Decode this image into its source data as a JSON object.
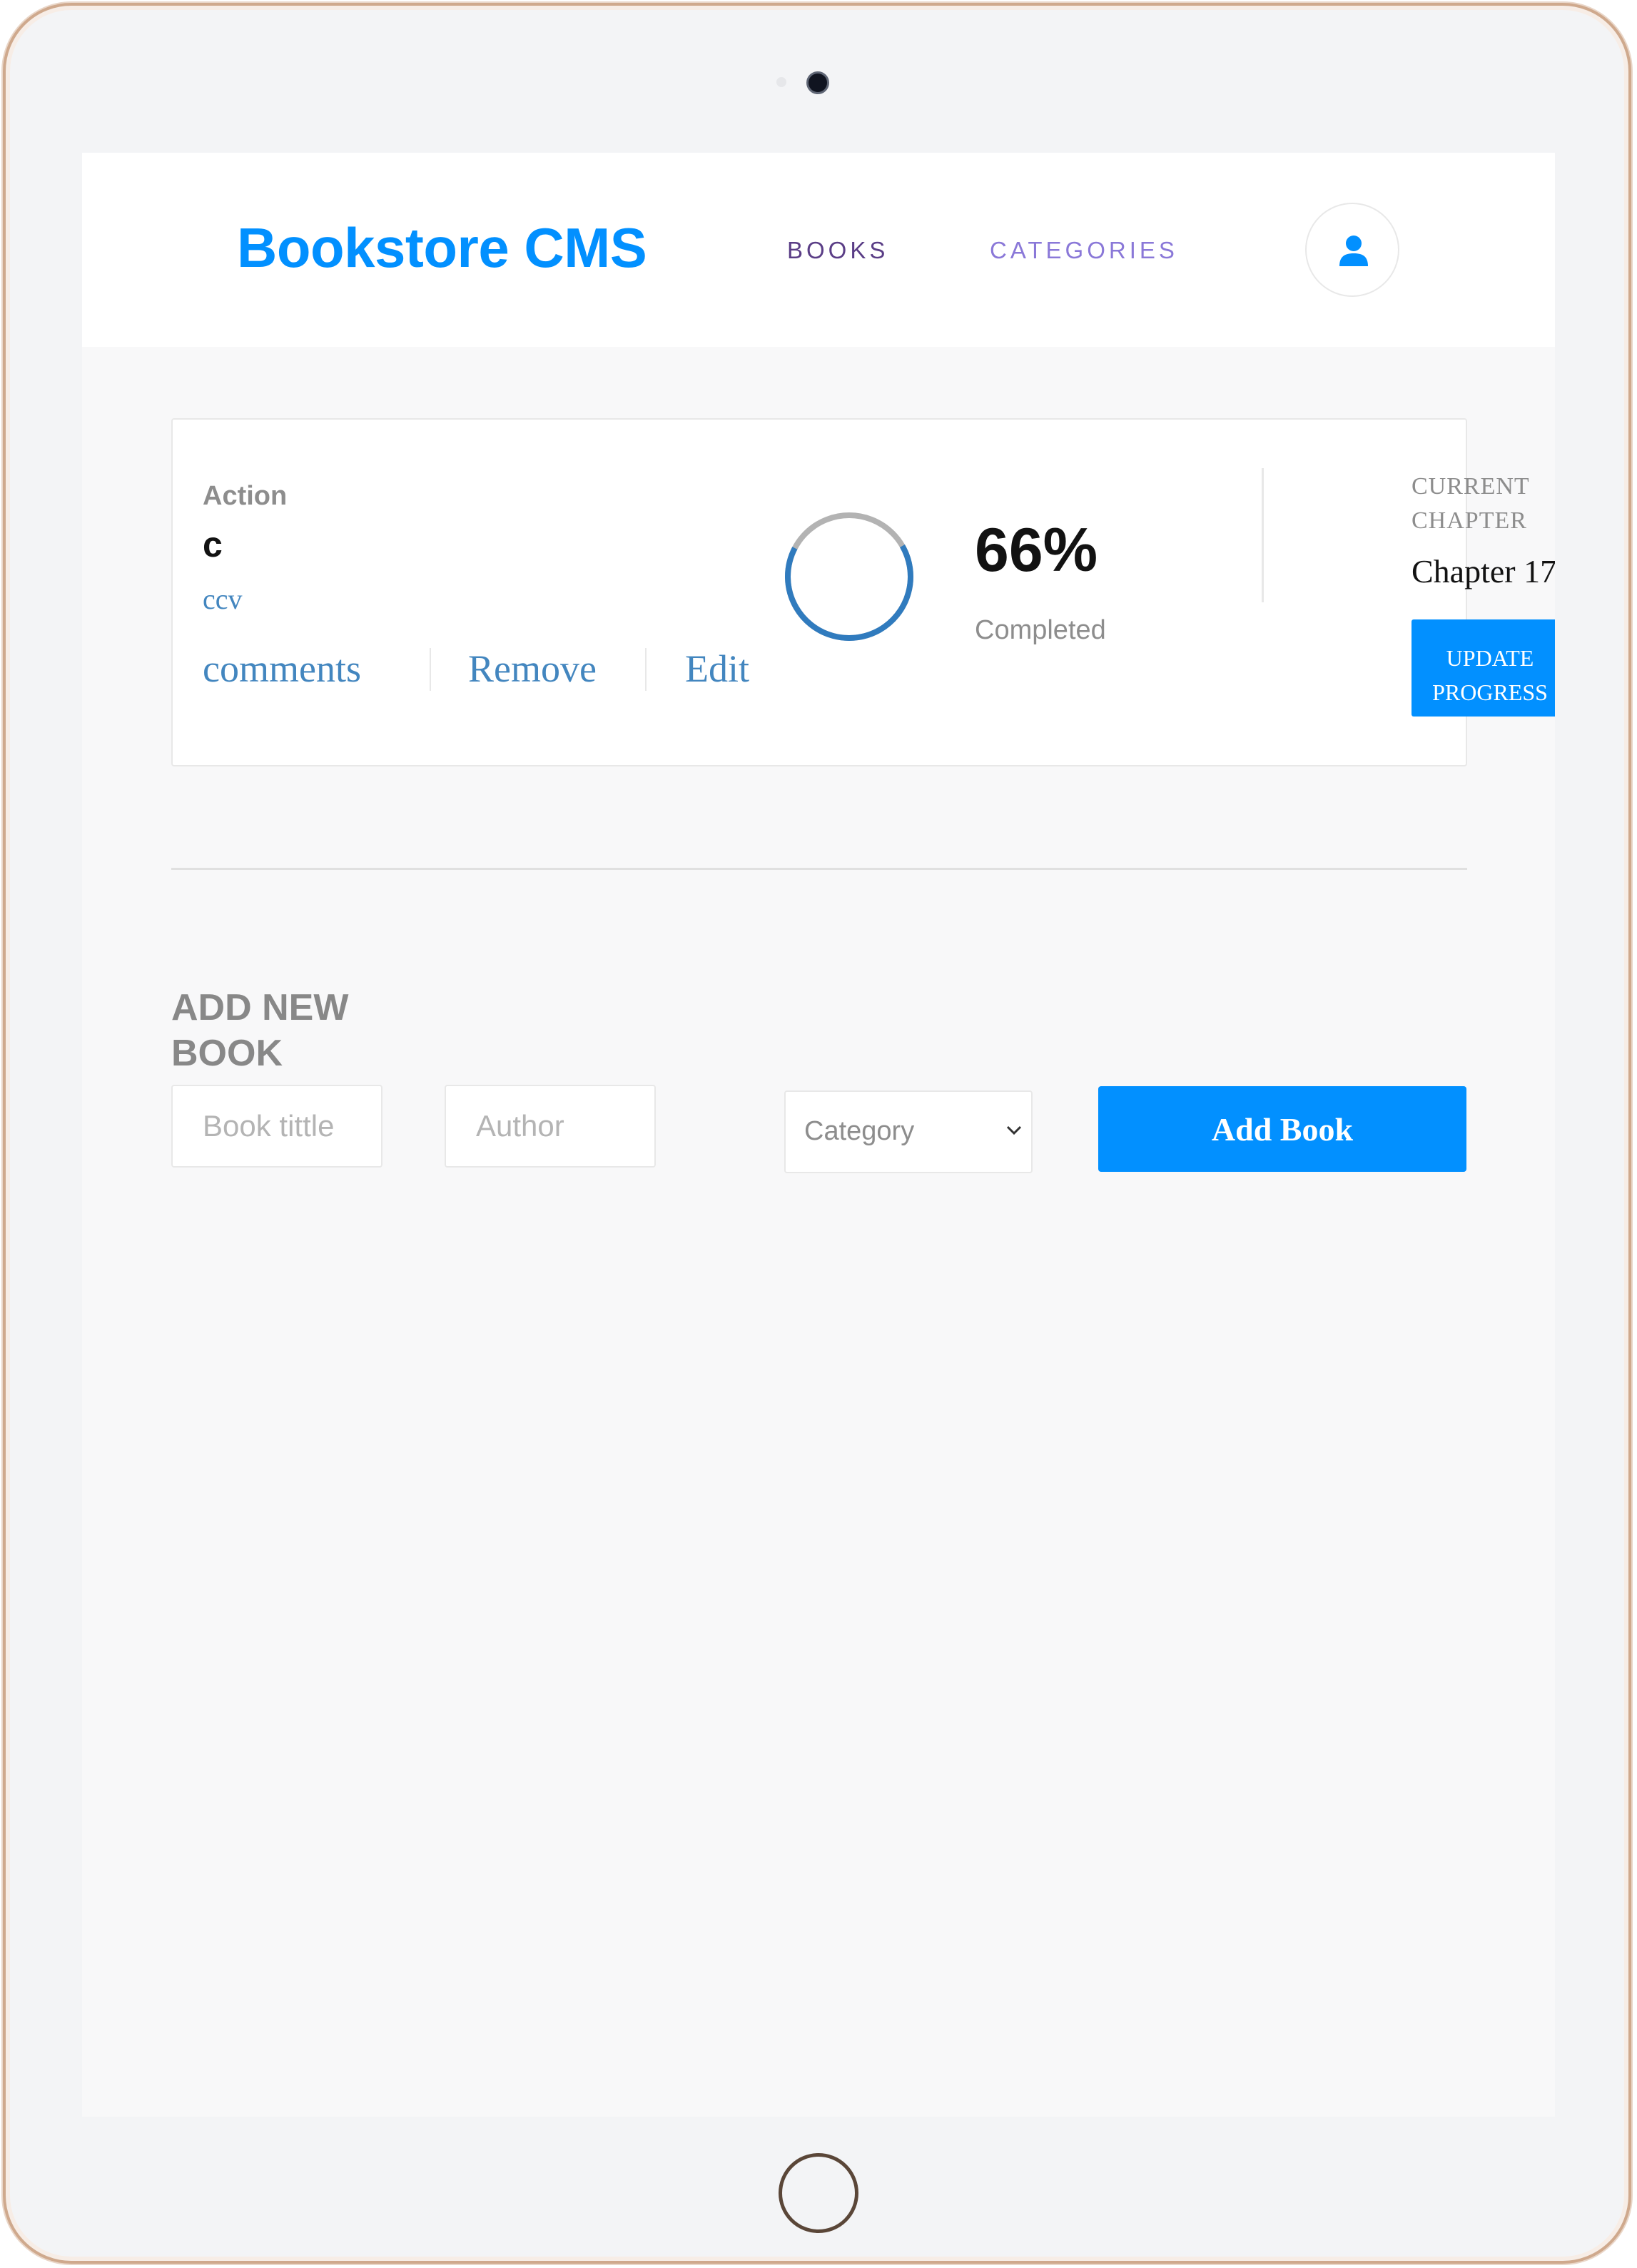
{
  "header": {
    "brand": "Bookstore CMS",
    "nav": [
      {
        "label": "BOOKS"
      },
      {
        "label": "CATEGORIES"
      }
    ],
    "user_icon": "user-icon"
  },
  "book": {
    "genre": "Action",
    "title": "c",
    "author": "ccv",
    "actions": [
      "comments",
      "Remove",
      "Edit"
    ],
    "progress_fraction": 0.66,
    "progress_label": "66%",
    "completed_label": "Completed",
    "chapter_label": "CURRENT CHAPTER",
    "chapter_value": "Chapter 17",
    "update_button": "UPDATE\nPROGRESS"
  },
  "form": {
    "title": "ADD NEW BOOK",
    "title_placeholder": "Book tittle",
    "author_placeholder": "Author",
    "category_selected": "Category",
    "add_button": "Add Book"
  },
  "colors": {
    "accent": "#0290ff",
    "link": "#4386bf",
    "progress_ring": "#307bbe",
    "progress_track": "#b3b3b3"
  }
}
